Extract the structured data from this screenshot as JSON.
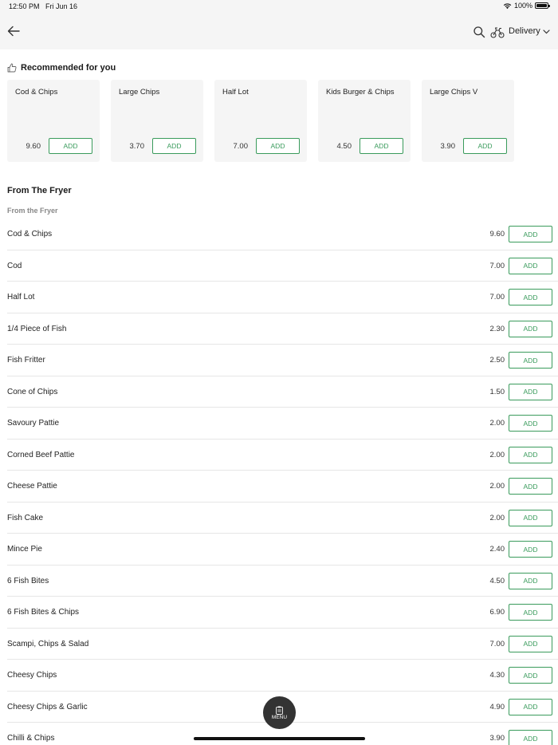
{
  "status": {
    "time": "12:50 PM",
    "date": "Fri Jun 16",
    "battery": "100%"
  },
  "header": {
    "delivery_label": "Delivery"
  },
  "recommended": {
    "title": "Recommended for you",
    "items": [
      {
        "name": "Cod & Chips",
        "price": "9.60",
        "add": "ADD"
      },
      {
        "name": "Large Chips",
        "price": "3.70",
        "add": "ADD"
      },
      {
        "name": "Half Lot",
        "price": "7.00",
        "add": "ADD"
      },
      {
        "name": "Kids Burger & Chips",
        "price": "4.50",
        "add": "ADD"
      },
      {
        "name": "Large Chips V",
        "price": "3.90",
        "add": "ADD"
      }
    ]
  },
  "section": {
    "title": "From The Fryer",
    "subtitle": "From the Fryer"
  },
  "items": [
    {
      "name": "Cod & Chips",
      "price": "9.60",
      "add": "ADD"
    },
    {
      "name": "Cod",
      "price": "7.00",
      "add": "ADD"
    },
    {
      "name": "Half Lot",
      "price": "7.00",
      "add": "ADD"
    },
    {
      "name": "1/4 Piece of Fish",
      "price": "2.30",
      "add": "ADD"
    },
    {
      "name": "Fish Fritter",
      "price": "2.50",
      "add": "ADD"
    },
    {
      "name": "Cone of Chips",
      "price": "1.50",
      "add": "ADD"
    },
    {
      "name": "Savoury Pattie",
      "price": "2.00",
      "add": "ADD"
    },
    {
      "name": "Corned Beef Pattie",
      "price": "2.00",
      "add": "ADD"
    },
    {
      "name": "Cheese Pattie",
      "price": "2.00",
      "add": "ADD"
    },
    {
      "name": "Fish Cake",
      "price": "2.00",
      "add": "ADD"
    },
    {
      "name": "Mince Pie",
      "price": "2.40",
      "add": "ADD"
    },
    {
      "name": "6 Fish Bites",
      "price": "4.50",
      "add": "ADD"
    },
    {
      "name": "6 Fish Bites & Chips",
      "price": "6.90",
      "add": "ADD"
    },
    {
      "name": "Scampi, Chips & Salad",
      "price": "7.00",
      "add": "ADD"
    },
    {
      "name": "Cheesy Chips",
      "price": "4.30",
      "add": "ADD"
    },
    {
      "name": "Cheesy Chips & Garlic",
      "price": "4.90",
      "add": "ADD"
    },
    {
      "name": "Chilli & Chips",
      "price": "3.90",
      "add": "ADD"
    }
  ],
  "menu_button": {
    "label": "MENU"
  },
  "colors": {
    "accent": "#3a9b5c",
    "header_bg": "#f5f5f5",
    "fab_bg": "#333333"
  },
  "icons": [
    "back-arrow-icon",
    "search-icon",
    "bike-icon",
    "chevron-down-icon",
    "thumbs-up-icon",
    "wifi-icon",
    "battery-icon",
    "menu-clipboard-icon"
  ]
}
